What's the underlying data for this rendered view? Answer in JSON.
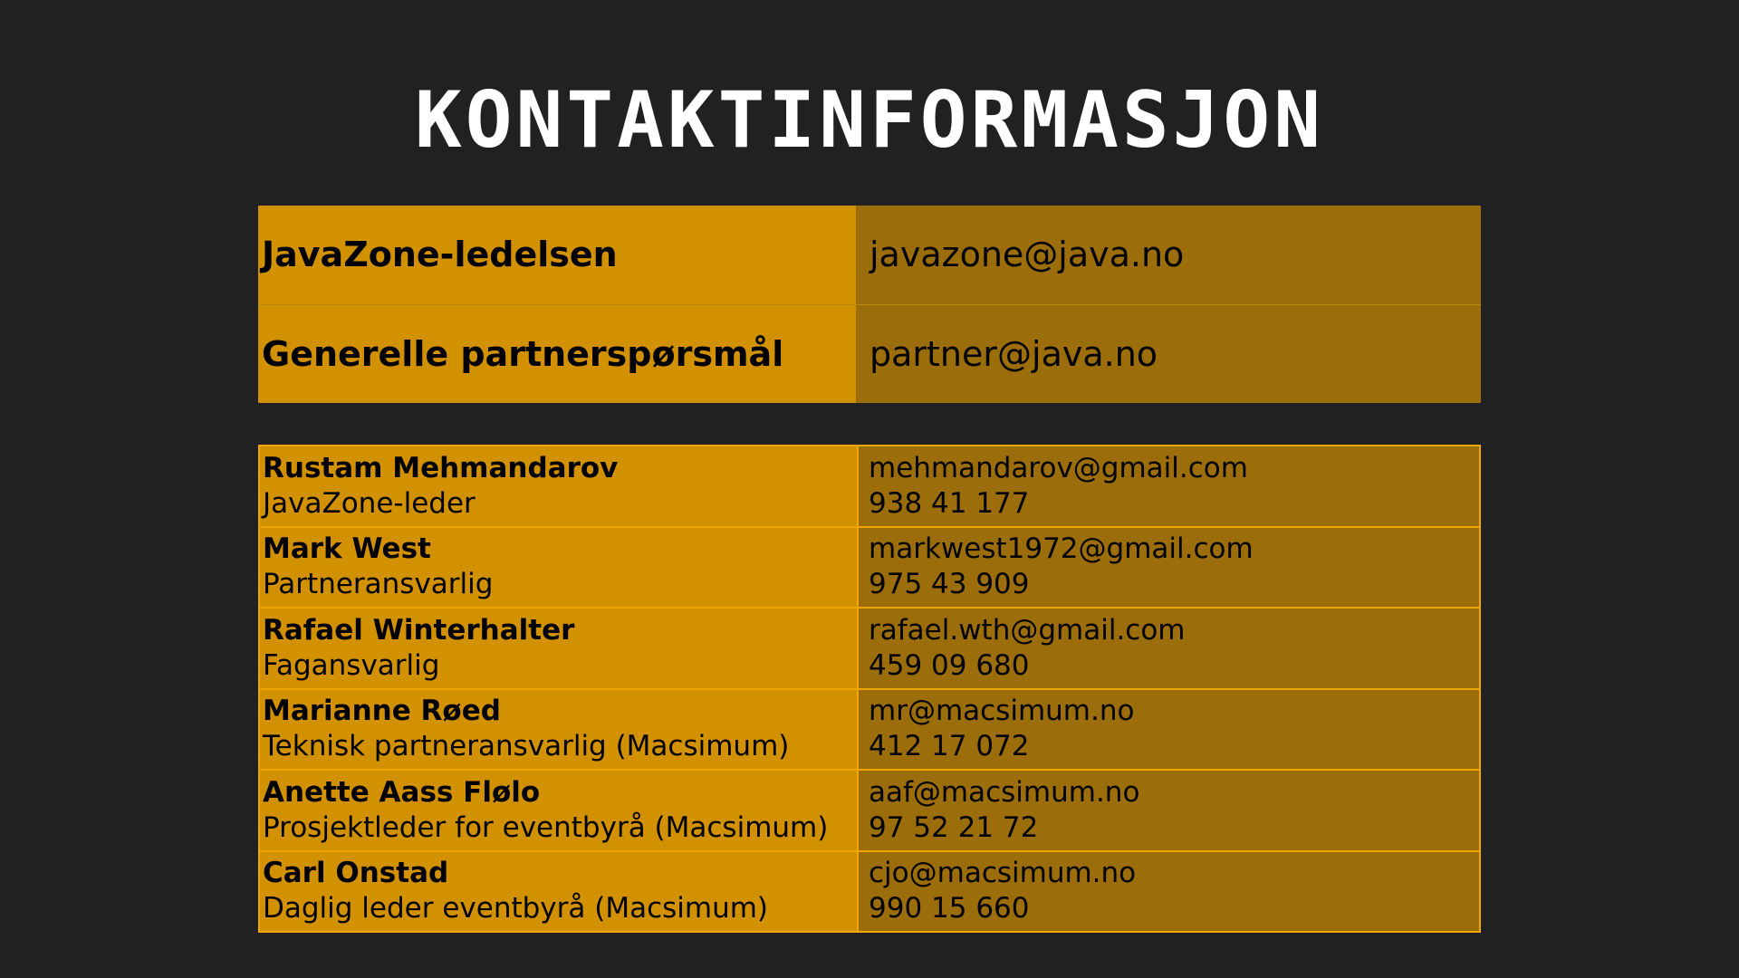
{
  "title": "KONTAKTINFORMASJON",
  "general": [
    {
      "label": "JavaZone-ledelsen",
      "email": "javazone@java.no"
    },
    {
      "label": "Generelle partnerspørsmål",
      "email": "partner@java.no"
    }
  ],
  "contacts": [
    {
      "name": "Rustam Mehmandarov",
      "role": "JavaZone-leder",
      "email": "mehmandarov@gmail.com",
      "phone": "938 41 177"
    },
    {
      "name": "Mark West",
      "role": "Partneransvarlig",
      "email": "markwest1972@gmail.com",
      "phone": "975 43 909"
    },
    {
      "name": "Rafael Winterhalter",
      "role": "Fagansvarlig",
      "email": "rafael.wth@gmail.com",
      "phone": "459 09 680"
    },
    {
      "name": "Marianne Røed",
      "role": "Teknisk partneransvarlig (Macsimum)",
      "email": "mr@macsimum.no",
      "phone": "412 17 072"
    },
    {
      "name": "Anette Aass Flølo",
      "role": "Prosjektleder for eventbyrå (Macsimum)",
      "email": "aaf@macsimum.no",
      "phone": "97 52 21 72"
    },
    {
      "name": "Carl Onstad",
      "role": "Daglig leder eventbyrå (Macsimum)",
      "email": "cjo@macsimum.no",
      "phone": "990 15 660"
    }
  ],
  "colors": {
    "background": "#212121",
    "label_cell": "#d19101",
    "value_cell": "#9b6d0b",
    "border": "#f0a500"
  }
}
